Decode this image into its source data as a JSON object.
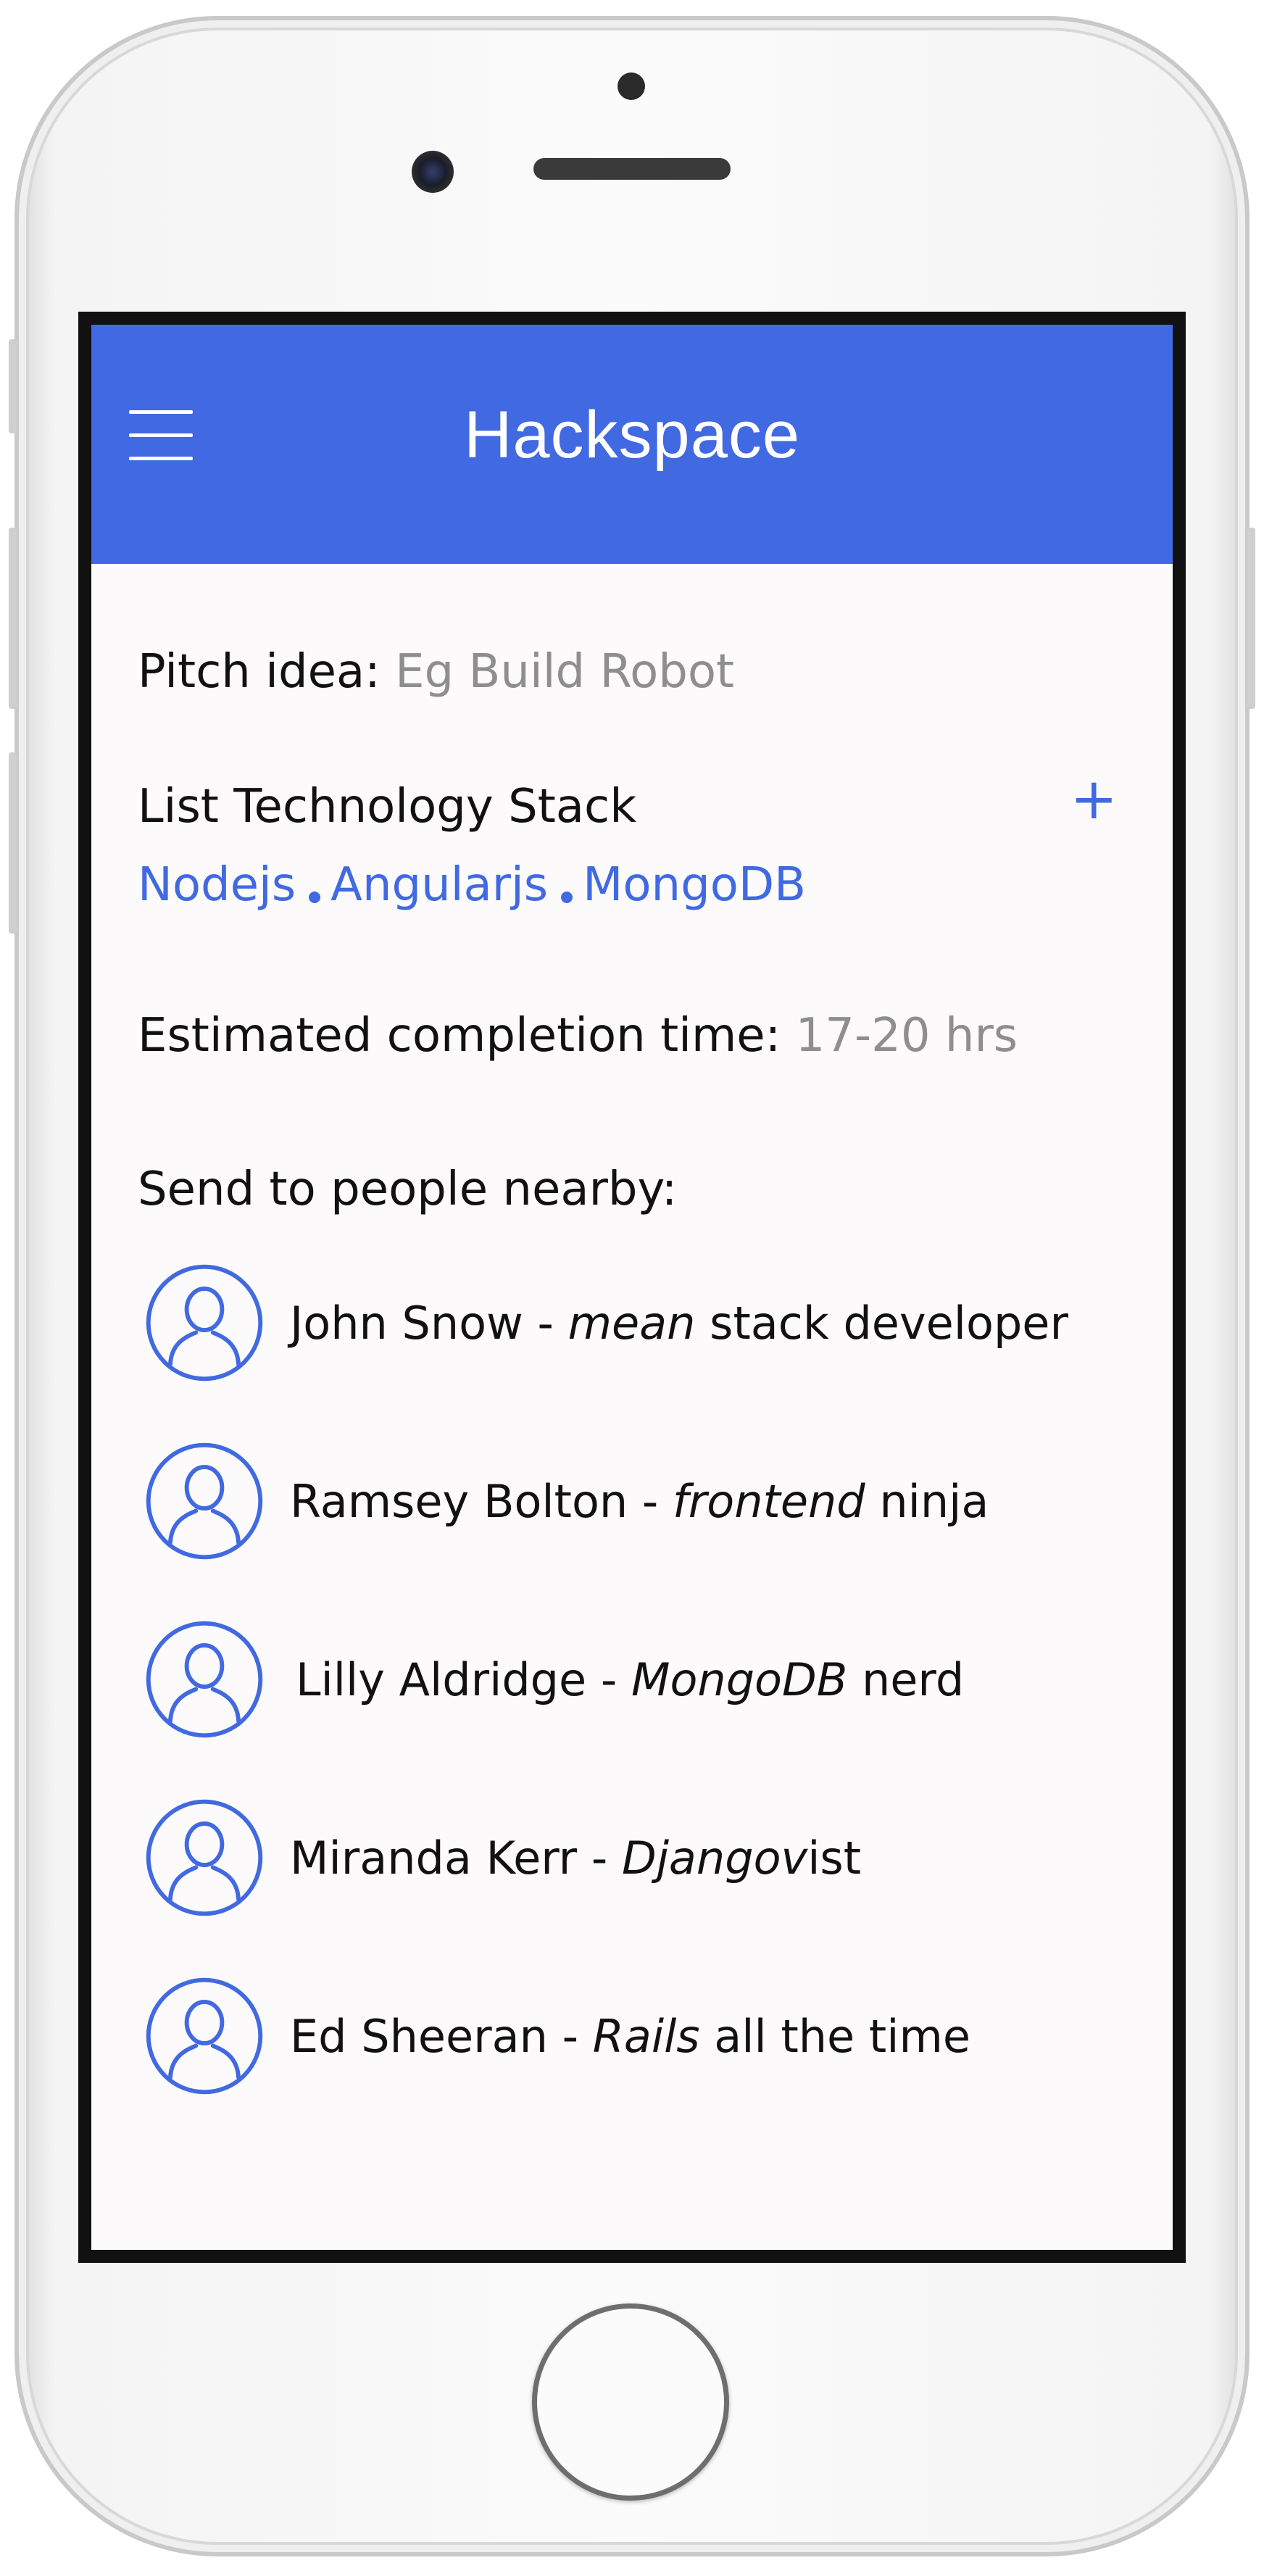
{
  "app": {
    "title": "Hackspace"
  },
  "pitch": {
    "label": "Pitch idea:",
    "value": "Eg Build Robot"
  },
  "stack": {
    "label": "List Technology Stack",
    "add_symbol": "+",
    "items": [
      "Nodejs",
      "Angularjs",
      "MongoDB"
    ]
  },
  "estimate": {
    "label": "Estimated completion time:",
    "value": "17-20 hrs"
  },
  "nearby": {
    "label": "Send to people nearby:",
    "people": [
      {
        "name": "John Snow",
        "separator": " - ",
        "role_emph": "mean",
        "role_rest": " stack developer"
      },
      {
        "name": "Ramsey Bolton",
        "separator": " - ",
        "role_emph": "frontend",
        "role_rest": " ninja"
      },
      {
        "name": "Lilly Aldridge",
        "separator": " - ",
        "role_emph": "MongoDB",
        "role_rest": " nerd"
      },
      {
        "name": "Miranda Kerr",
        "separator": " - ",
        "role_emph": "Djangov",
        "role_rest": "ist"
      },
      {
        "name": "Ed Sheeran",
        "separator": " - ",
        "role_emph": "Rails",
        "role_rest": " all the time"
      }
    ]
  },
  "icons": {
    "menu": "hamburger-menu-icon",
    "add": "plus-icon",
    "avatar": "user-avatar-icon"
  },
  "colors": {
    "accent": "#4169e1",
    "screen_bg": "#fcfafa",
    "text": "#111111",
    "muted": "#8e8e8e"
  }
}
